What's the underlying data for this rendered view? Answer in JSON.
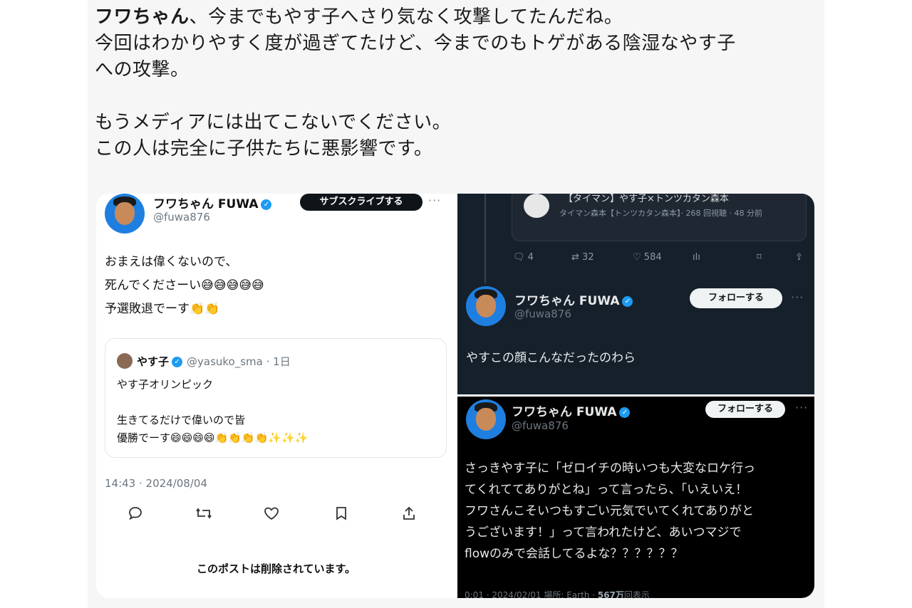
{
  "post": {
    "author_bold": "フワちゃん",
    "line1_rest": "、今までもやす子へさり気なく攻撃してたんだね。",
    "line2": "今回はわかりやすく度が過ぎてたけど、今までのもトゲがある陰湿なやす子",
    "line3": "への攻撃。",
    "line4": "もうメディアには出てこないでください。",
    "line5": "この人は完全に子供たちに悪影響です。"
  },
  "left_card": {
    "name": "フワちゃん FUWA",
    "handle": "@fuwa876",
    "subscribe_label": "サブスクライブする",
    "more": "···",
    "body_line1": "おまえは偉くないので、",
    "body_line2": "死んでくださーい",
    "body_line2_emoji": "😅😅😅😅😅",
    "body_line3": "予選敗退でーす",
    "body_line3_emoji": "👏👏",
    "quote": {
      "name": "やす子",
      "handle_date": "@yasuko_sma · 1日",
      "line1": "やす子オリンピック",
      "line2": "生きてるだけで偉いので皆",
      "line3": "優勝でーす",
      "line3_emoji": "😄😄😄😄👏👏👏👏✨✨✨"
    },
    "timestamp": "14:43 · 2024/08/04",
    "deleted_notice": "このポストは削除されています。"
  },
  "panel_a": {
    "embed_title": "【タイマン】やす子×トンツカタン森本",
    "embed_meta": "タイマン森本【トンツカタン森本】· 268 回視聴 · 48 分前",
    "replies": "4",
    "reposts": "32",
    "likes": "584",
    "name": "フワちゃん FUWA",
    "handle": "@fuwa876",
    "follow_label": "フォローする",
    "more": "···",
    "body": "やすこの顔こんなだったのわら"
  },
  "panel_b": {
    "name": "フワちゃん FUWA",
    "handle": "@fuwa876",
    "follow_label": "フォローする",
    "more": "···",
    "body_line1": "さっきやす子に「ゼロイチの時いつも大変なロケ行っ",
    "body_line2": "てくれててありがとね」って言ったら、「いえいえ！",
    "body_line3": "フワさんこそいつもすごい元気でいてくれてありがと",
    "body_line4": "うございます！」って言われたけど、あいつマジで",
    "body_line5": "flowのみで会話してるよな？？？？？？",
    "footer_time": "0:01 · 2024/02/01 場所: Earth · ",
    "footer_views": "567万",
    "footer_views_label": "回表示"
  }
}
